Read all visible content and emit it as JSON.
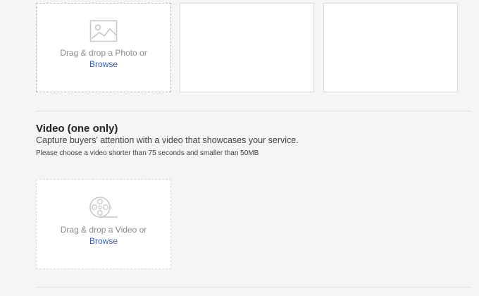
{
  "photos": {
    "drop_text": "Drag & drop a Photo or",
    "browse_label": "Browse",
    "icon": "image-icon"
  },
  "video": {
    "title": "Video (one only)",
    "subtitle": "Capture buyers' attention with a video that showcases your service.",
    "note": "Please choose a video shorter than 75 seconds and smaller than 50MB",
    "drop_text": "Drag & drop a Video or",
    "browse_label": "Browse",
    "icon": "film-reel-icon"
  },
  "colors": {
    "link": "#3860be",
    "muted": "#8a8c91",
    "background": "#f5f5f5"
  }
}
